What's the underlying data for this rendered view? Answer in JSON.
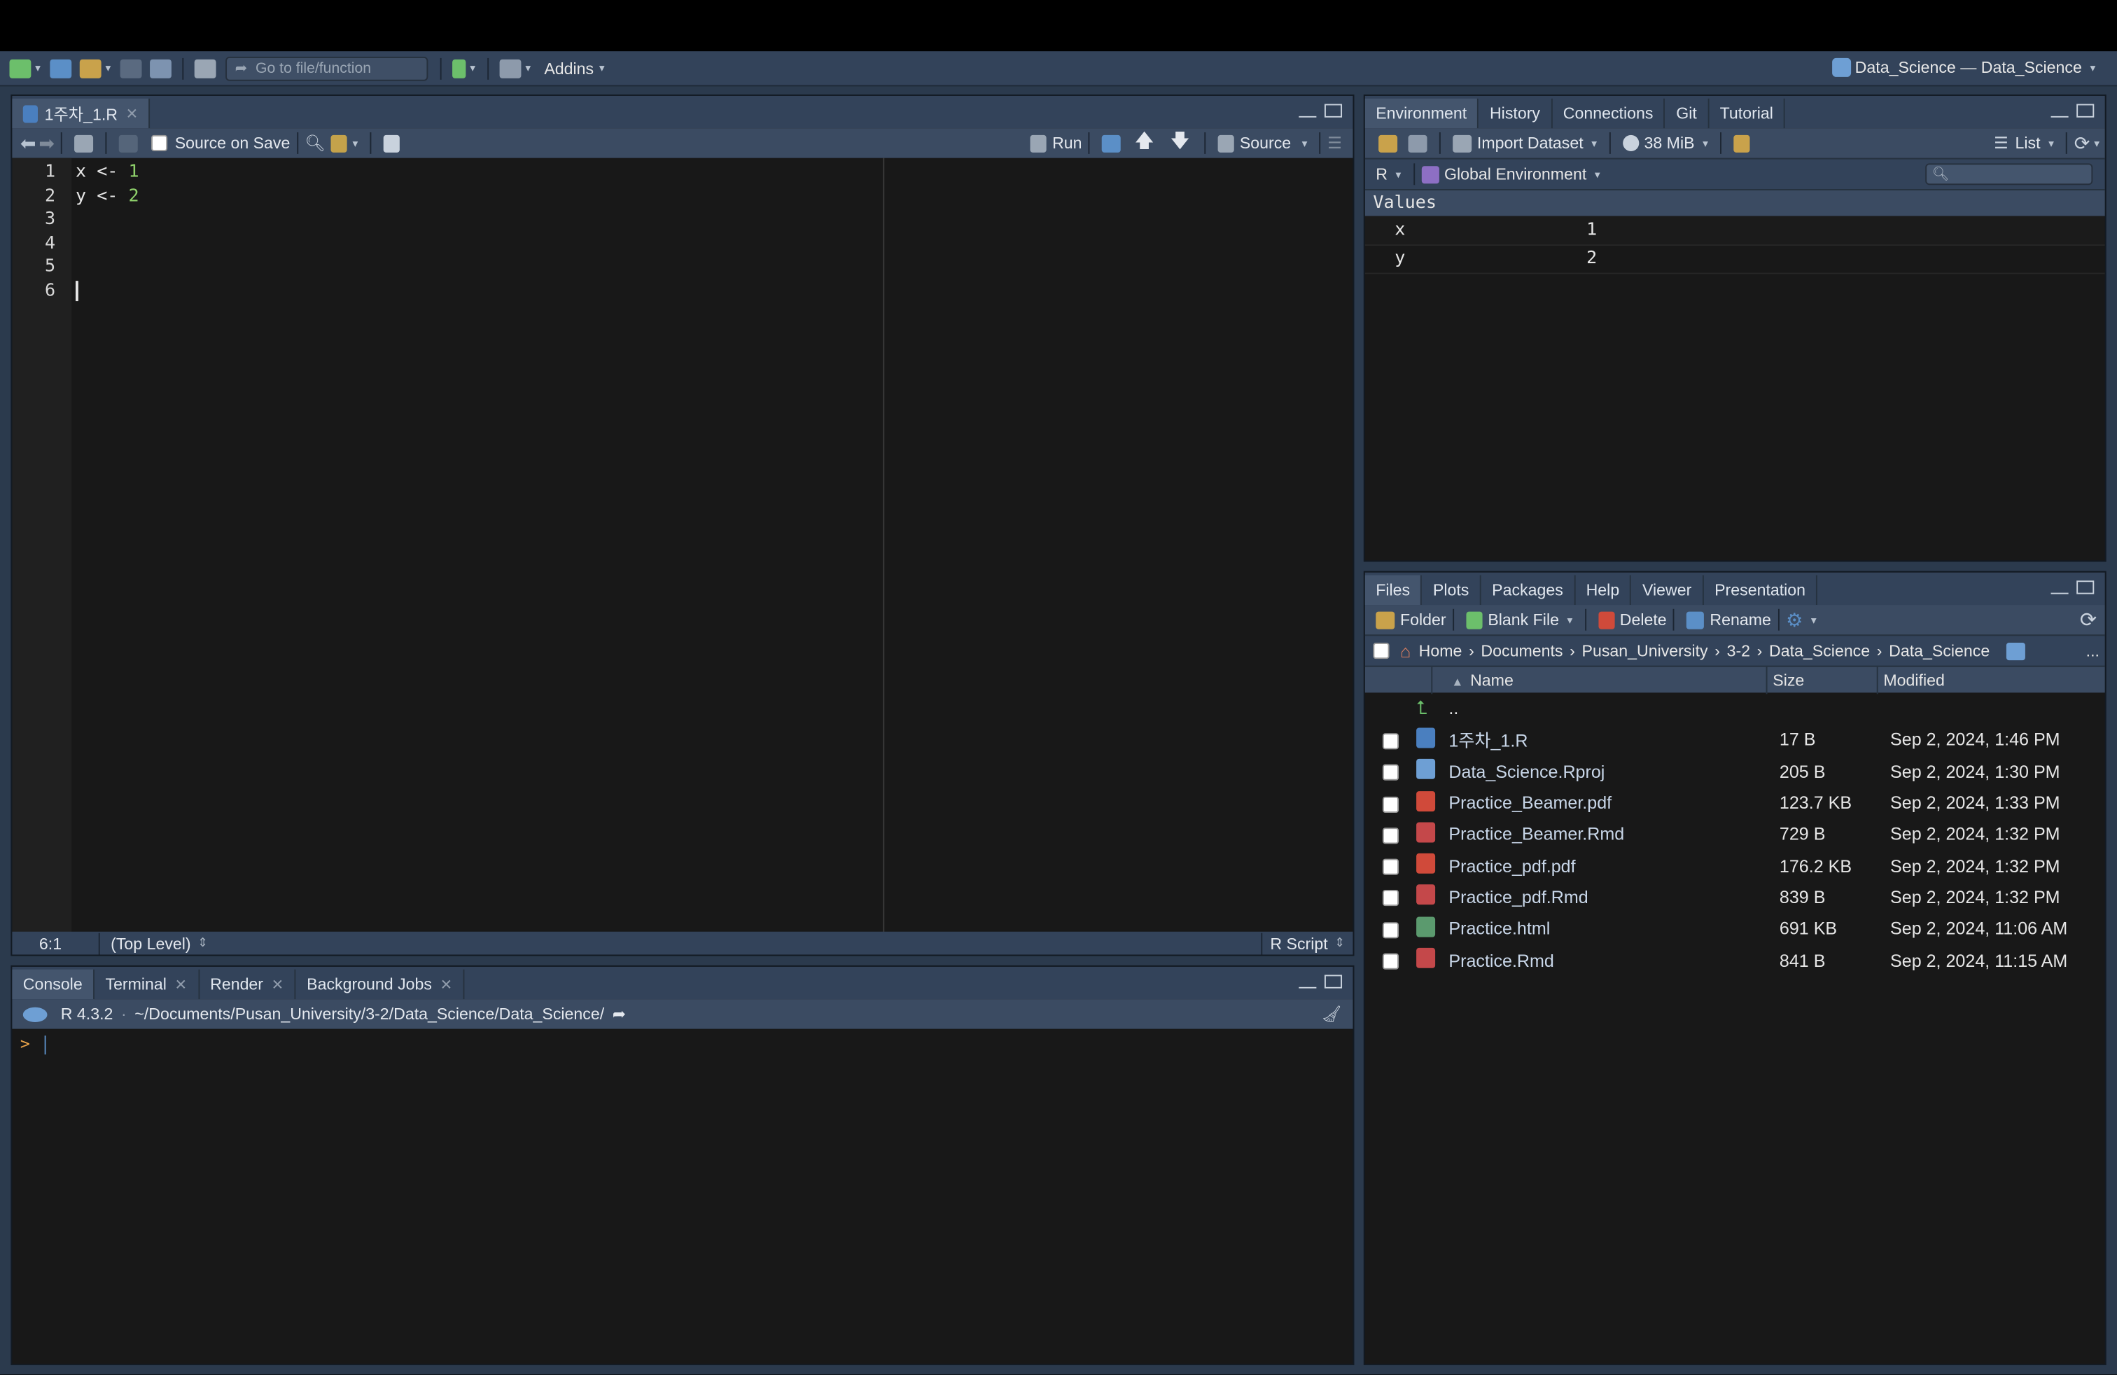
{
  "toolbar": {
    "goto_placeholder": "Go to file/function",
    "addins": "Addins",
    "project": "Data_Science — Data_Science"
  },
  "source": {
    "tab": "1주차_1.R",
    "source_on_save": "Source on Save",
    "run": "Run",
    "source": "Source",
    "line_numbers": [
      "1",
      "2",
      "3",
      "4",
      "5",
      "6"
    ],
    "lines": [
      {
        "var": "x",
        "op": "<-",
        "val": "1"
      },
      {
        "var": "y",
        "op": "<-",
        "val": "2"
      }
    ],
    "status": {
      "position": "6:1",
      "scope": "(Top Level)",
      "type": "R Script"
    }
  },
  "console": {
    "tabs": [
      "Console",
      "Terminal",
      "Render",
      "Background Jobs"
    ],
    "version": "R 4.3.2",
    "path": "~/Documents/Pusan_University/3-2/Data_Science/Data_Science/",
    "prompt": ">"
  },
  "environment": {
    "tabs": [
      "Environment",
      "History",
      "Connections",
      "Git",
      "Tutorial"
    ],
    "import_dataset": "Import Dataset",
    "memory": "38 MiB",
    "list": "List",
    "lang": "R",
    "scope": "Global Environment",
    "section": "Values",
    "values": [
      {
        "name": "x",
        "value": "1"
      },
      {
        "name": "y",
        "value": "2"
      }
    ]
  },
  "files": {
    "tabs": [
      "Files",
      "Plots",
      "Packages",
      "Help",
      "Viewer",
      "Presentation"
    ],
    "folder": "Folder",
    "blank_file": "Blank File",
    "delete": "Delete",
    "rename": "Rename",
    "breadcrumb": [
      "Home",
      "Documents",
      "Pusan_University",
      "3-2",
      "Data_Science",
      "Data_Science"
    ],
    "more": "...",
    "headers": {
      "name": "Name",
      "size": "Size",
      "modified": "Modified"
    },
    "parent": "..",
    "rows": [
      {
        "name": "1주차_1.R",
        "size": "17 B",
        "modified": "Sep 2, 2024, 1:46 PM",
        "icon": "r-script-icon",
        "color": "#4a7fbf"
      },
      {
        "name": "Data_Science.Rproj",
        "size": "205 B",
        "modified": "Sep 2, 2024, 1:30 PM",
        "icon": "rproj-icon",
        "color": "#6e9fd4"
      },
      {
        "name": "Practice_Beamer.pdf",
        "size": "123.7 KB",
        "modified": "Sep 2, 2024, 1:33 PM",
        "icon": "pdf-icon",
        "color": "#d04a3a"
      },
      {
        "name": "Practice_Beamer.Rmd",
        "size": "729 B",
        "modified": "Sep 2, 2024, 1:32 PM",
        "icon": "rmd-icon",
        "color": "#c4484a"
      },
      {
        "name": "Practice_pdf.pdf",
        "size": "176.2 KB",
        "modified": "Sep 2, 2024, 1:32 PM",
        "icon": "pdf-icon",
        "color": "#d04a3a"
      },
      {
        "name": "Practice_pdf.Rmd",
        "size": "839 B",
        "modified": "Sep 2, 2024, 1:32 PM",
        "icon": "rmd-icon",
        "color": "#c4484a"
      },
      {
        "name": "Practice.html",
        "size": "691 KB",
        "modified": "Sep 2, 2024, 11:06 AM",
        "icon": "html-icon",
        "color": "#5b9a6e"
      },
      {
        "name": "Practice.Rmd",
        "size": "841 B",
        "modified": "Sep 2, 2024, 11:15 AM",
        "icon": "rmd-icon",
        "color": "#c4484a"
      }
    ]
  }
}
